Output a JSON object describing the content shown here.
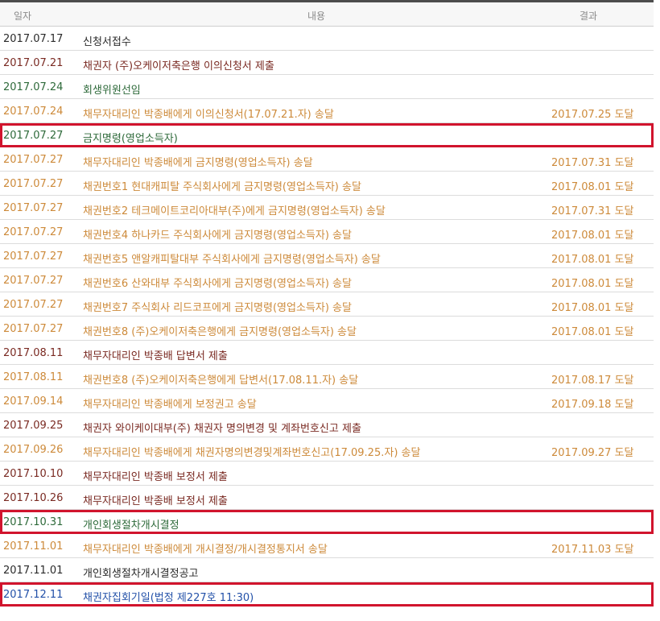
{
  "headers": {
    "date": "일자",
    "content": "내용",
    "result": "결과"
  },
  "colors": {
    "black": "#2a2a2a",
    "maroon": "#7a2a22",
    "green": "#2e6a3a",
    "orange": "#cd8a3a",
    "blue": "#2250a8",
    "highlight_border": "#d1142d"
  },
  "rows": [
    {
      "date": "2017.07.17",
      "content": "신청서접수",
      "result": "",
      "color": "black",
      "highlighted": false
    },
    {
      "date": "2017.07.21",
      "content": "채권자 (주)오케이저축은행 이의신청서 제출",
      "result": "",
      "color": "maroon",
      "highlighted": false
    },
    {
      "date": "2017.07.24",
      "content": "회생위원선임",
      "result": "",
      "color": "green",
      "highlighted": false
    },
    {
      "date": "2017.07.24",
      "content": "채무자대리인 박종배에게 이의신청서(17.07.21.자) 송달",
      "result": "2017.07.25 도달",
      "color": "orange",
      "highlighted": false
    },
    {
      "date": "2017.07.27",
      "content": "금지명령(영업소득자)",
      "result": "",
      "color": "green",
      "highlighted": true
    },
    {
      "date": "2017.07.27",
      "content": "채무자대리인 박종배에게 금지명령(영업소득자) 송달",
      "result": "2017.07.31 도달",
      "color": "orange",
      "highlighted": false
    },
    {
      "date": "2017.07.27",
      "content": "채권번호1 현대캐피탈 주식회사에게 금지명령(영업소득자) 송달",
      "result": "2017.08.01 도달",
      "color": "orange",
      "highlighted": false
    },
    {
      "date": "2017.07.27",
      "content": "채권번호2 테크메이트코리아대부(주)에게 금지명령(영업소득자) 송달",
      "result": "2017.07.31 도달",
      "color": "orange",
      "highlighted": false
    },
    {
      "date": "2017.07.27",
      "content": "채권번호4 하나카드 주식회사에게 금지명령(영업소득자) 송달",
      "result": "2017.08.01 도달",
      "color": "orange",
      "highlighted": false
    },
    {
      "date": "2017.07.27",
      "content": "채권번호5 앤알캐피탈대부 주식회사에게 금지명령(영업소득자) 송달",
      "result": "2017.08.01 도달",
      "color": "orange",
      "highlighted": false
    },
    {
      "date": "2017.07.27",
      "content": "채권번호6 산와대부 주식회사에게 금지명령(영업소득자) 송달",
      "result": "2017.08.01 도달",
      "color": "orange",
      "highlighted": false
    },
    {
      "date": "2017.07.27",
      "content": "채권번호7 주식회사 리드코프에게 금지명령(영업소득자) 송달",
      "result": "2017.08.01 도달",
      "color": "orange",
      "highlighted": false
    },
    {
      "date": "2017.07.27",
      "content": "채권번호8 (주)오케이저축은행에게 금지명령(영업소득자) 송달",
      "result": "2017.08.01 도달",
      "color": "orange",
      "highlighted": false
    },
    {
      "date": "2017.08.11",
      "content": "채무자대리인 박종배 답변서 제출",
      "result": "",
      "color": "maroon",
      "highlighted": false
    },
    {
      "date": "2017.08.11",
      "content": "채권번호8 (주)오케이저축은행에게 답변서(17.08.11.자) 송달",
      "result": "2017.08.17 도달",
      "color": "orange",
      "highlighted": false
    },
    {
      "date": "2017.09.14",
      "content": "채무자대리인 박종배에게 보정권고 송달",
      "result": "2017.09.18 도달",
      "color": "orange",
      "highlighted": false
    },
    {
      "date": "2017.09.25",
      "content": "채권자 와이케이대부(주) 채권자 명의변경 및 계좌번호신고 제출",
      "result": "",
      "color": "maroon",
      "highlighted": false
    },
    {
      "date": "2017.09.26",
      "content": "채무자대리인 박종배에게 채권자명의변경및계좌번호신고(17.09.25.자) 송달",
      "result": "2017.09.27 도달",
      "color": "orange",
      "highlighted": false
    },
    {
      "date": "2017.10.10",
      "content": "채무자대리인 박종배 보정서 제출",
      "result": "",
      "color": "maroon",
      "highlighted": false
    },
    {
      "date": "2017.10.26",
      "content": "채무자대리인 박종배 보정서 제출",
      "result": "",
      "color": "maroon",
      "highlighted": false
    },
    {
      "date": "2017.10.31",
      "content": "개인회생절차개시결정",
      "result": "",
      "color": "green",
      "highlighted": true
    },
    {
      "date": "2017.11.01",
      "content": "채무자대리인 박종배에게 개시결정/개시결정통지서 송달",
      "result": "2017.11.03 도달",
      "color": "orange",
      "highlighted": false
    },
    {
      "date": "2017.11.01",
      "content": "개인회생절차개시결정공고",
      "result": "",
      "color": "black",
      "highlighted": false
    },
    {
      "date": "2017.12.11",
      "content": "채권자집회기일(법정 제227호 11:30)",
      "result": "",
      "color": "blue",
      "highlighted": true
    }
  ]
}
